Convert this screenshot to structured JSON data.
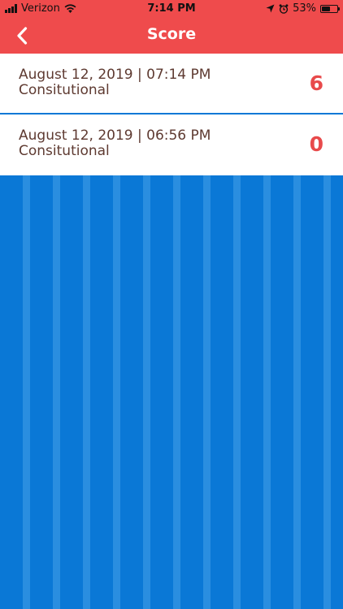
{
  "status_bar": {
    "carrier": "Verizon",
    "time": "7:14 PM",
    "battery_percent": "53%",
    "battery_level": 0.53
  },
  "nav": {
    "title": "Score"
  },
  "scores": [
    {
      "date": "August 12, 2019 | 07:14 PM",
      "category": "Consitutional",
      "score": "6"
    },
    {
      "date": "August 12, 2019 | 06:56 PM",
      "category": "Consitutional",
      "score": "0"
    }
  ],
  "colors": {
    "header": "#ef4b4c",
    "background": "#0a78d6",
    "score": "#e84a4b",
    "text": "#5e3a31"
  }
}
